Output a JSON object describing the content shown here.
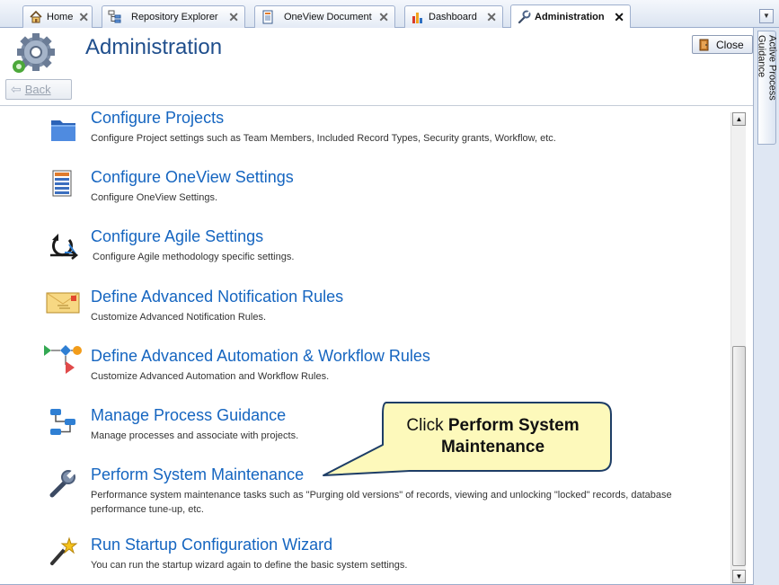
{
  "tabs": [
    {
      "label": "Home",
      "icon": "home-icon",
      "active": false
    },
    {
      "label": "Repository Explorer",
      "icon": "tree-icon",
      "active": false
    },
    {
      "label": "OneView Document",
      "icon": "document-icon",
      "active": false
    },
    {
      "label": "Dashboard",
      "icon": "bar-chart-icon",
      "active": false
    },
    {
      "label": "Administration",
      "icon": "wrench-icon",
      "active": true
    }
  ],
  "header": {
    "title": "Administration",
    "close_label": "Close",
    "back_label": "Back"
  },
  "side_panel": {
    "label": "Active Process Guidance"
  },
  "items": [
    {
      "title": "Configure Projects",
      "description": "Configure Project  settings such as Team Members, Included Record Types, Security grants, Workflow, etc.",
      "icon": "folder-icon"
    },
    {
      "title": "Configure OneView Settings",
      "description": "Configure OneView Settings.",
      "icon": "oneview-document-icon"
    },
    {
      "title": "Configure Agile Settings",
      "description": "Configure Agile methodology specific settings.",
      "icon": "agile-cycle-icon"
    },
    {
      "title": "Define Advanced Notification Rules",
      "description": "Customize Advanced Notification Rules.",
      "icon": "envelope-icon"
    },
    {
      "title": "Define Advanced Automation & Workflow Rules",
      "description": "Customize Advanced Automation and Workflow Rules.",
      "icon": "workflow-icon"
    },
    {
      "title": "Manage Process Guidance",
      "description": "Manage processes and associate with projects.",
      "icon": "process-guidance-icon"
    },
    {
      "title": "Perform System Maintenance",
      "description": "Performance system maintenance tasks such as \"Purging old versions\" of records, viewing and unlocking \"locked\" records, database performance tune-up, etc.",
      "icon": "wrench-icon"
    },
    {
      "title": "Run Startup Configuration Wizard",
      "description": "You can run the startup wizard again to define the basic system settings.",
      "icon": "magic-wand-icon"
    }
  ],
  "callout": {
    "prefix": "Click ",
    "bold": "Perform System Maintenance"
  },
  "colors": {
    "accent": "#1565c0",
    "title": "#1f4e8c",
    "callout_fill": "#fdf9bb",
    "callout_border": "#1d3d66"
  }
}
